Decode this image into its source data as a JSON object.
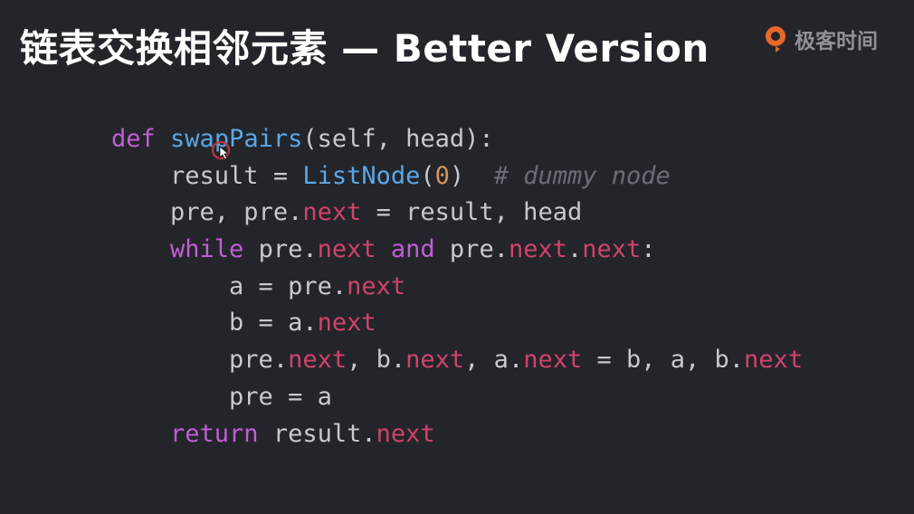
{
  "slide": {
    "title": "链表交换相邻元素 — Better Version",
    "brand": {
      "name": "极客时间",
      "logo_icon": "geektime-logo-icon",
      "accent_color": "#e8672a"
    }
  },
  "code": {
    "language": "python",
    "lines": [
      {
        "indent": "",
        "tokens": [
          {
            "t": "def",
            "c": "kw"
          },
          {
            "t": " ",
            "c": "plain"
          },
          {
            "t": "swapPairs",
            "c": "fn"
          },
          {
            "t": "(self, head):",
            "c": "plain"
          }
        ]
      },
      {
        "indent": "    ",
        "tokens": [
          {
            "t": "result = ",
            "c": "plain"
          },
          {
            "t": "ListNode",
            "c": "fn"
          },
          {
            "t": "(",
            "c": "plain"
          },
          {
            "t": "0",
            "c": "num"
          },
          {
            "t": ")  ",
            "c": "plain"
          },
          {
            "t": "# dummy node",
            "c": "cmt"
          }
        ]
      },
      {
        "indent": "    ",
        "tokens": [
          {
            "t": "pre, pre.",
            "c": "plain"
          },
          {
            "t": "next",
            "c": "attr"
          },
          {
            "t": " = result, head",
            "c": "plain"
          }
        ]
      },
      {
        "indent": "    ",
        "tokens": [
          {
            "t": "while",
            "c": "kw"
          },
          {
            "t": " pre.",
            "c": "plain"
          },
          {
            "t": "next",
            "c": "attr"
          },
          {
            "t": " ",
            "c": "plain"
          },
          {
            "t": "and",
            "c": "kw"
          },
          {
            "t": " pre.",
            "c": "plain"
          },
          {
            "t": "next",
            "c": "attr"
          },
          {
            "t": ".",
            "c": "plain"
          },
          {
            "t": "next",
            "c": "attr"
          },
          {
            "t": ":",
            "c": "plain"
          }
        ]
      },
      {
        "indent": "        ",
        "tokens": [
          {
            "t": "a = pre.",
            "c": "plain"
          },
          {
            "t": "next",
            "c": "attr"
          }
        ]
      },
      {
        "indent": "        ",
        "tokens": [
          {
            "t": "b = a.",
            "c": "plain"
          },
          {
            "t": "next",
            "c": "attr"
          }
        ]
      },
      {
        "indent": "        ",
        "tokens": [
          {
            "t": "pre.",
            "c": "plain"
          },
          {
            "t": "next",
            "c": "attr"
          },
          {
            "t": ", b.",
            "c": "plain"
          },
          {
            "t": "next",
            "c": "attr"
          },
          {
            "t": ", a.",
            "c": "plain"
          },
          {
            "t": "next",
            "c": "attr"
          },
          {
            "t": " = b, a, b.",
            "c": "plain"
          },
          {
            "t": "next",
            "c": "attr"
          }
        ]
      },
      {
        "indent": "        ",
        "tokens": [
          {
            "t": "pre = a",
            "c": "plain"
          }
        ]
      },
      {
        "indent": "    ",
        "tokens": [
          {
            "t": "return",
            "c": "kw"
          },
          {
            "t": " result.",
            "c": "plain"
          },
          {
            "t": "next",
            "c": "attr"
          }
        ]
      }
    ]
  },
  "pointer": {
    "icon": "mouse-pointer-icon"
  }
}
